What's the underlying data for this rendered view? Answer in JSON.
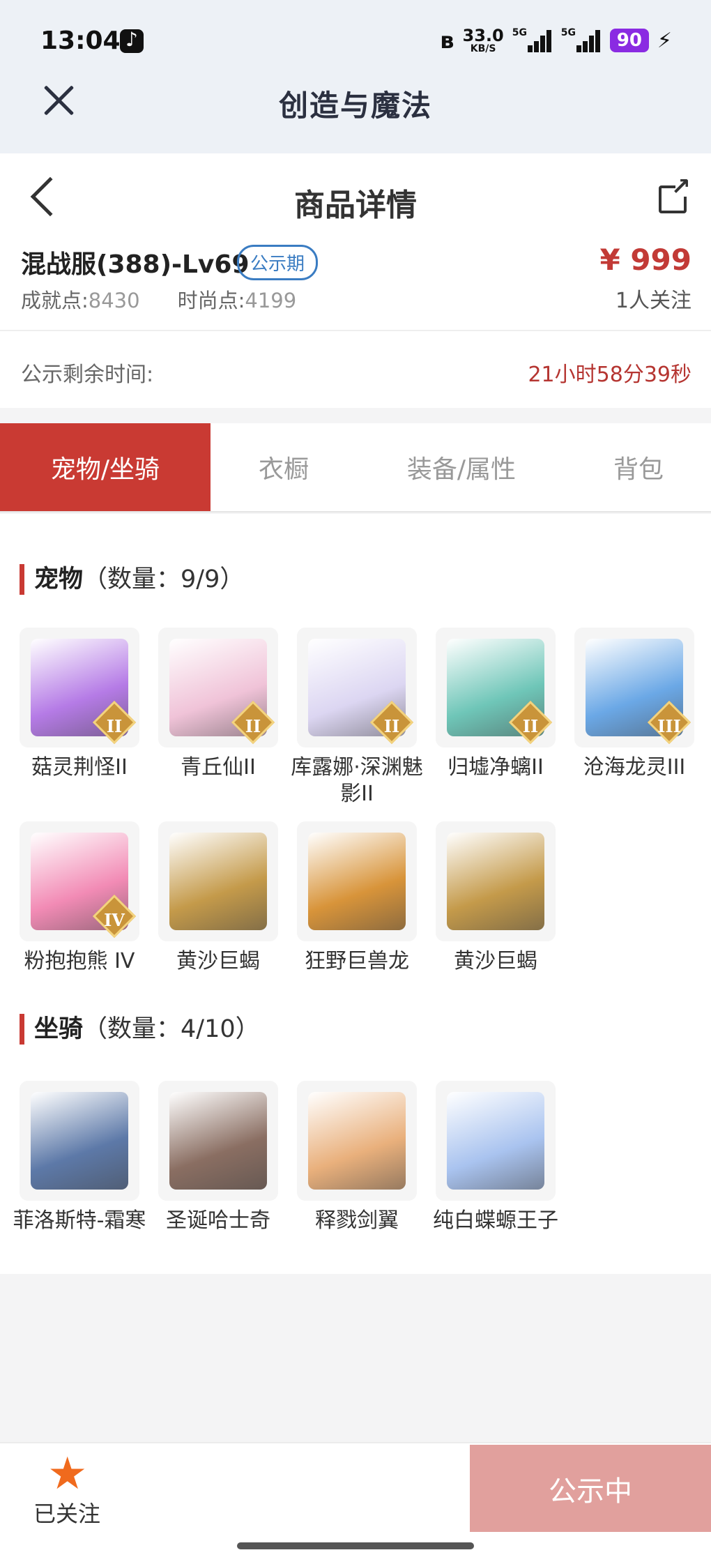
{
  "status_bar": {
    "time": "13:04",
    "net_speed_value": "33.0",
    "net_speed_unit": "KB/S",
    "signal1_label": "5G",
    "signal2_label": "5G",
    "battery": "90"
  },
  "app": {
    "title": "创造与魔法"
  },
  "page": {
    "title": "商品详情"
  },
  "item": {
    "name": "混战服(388)-Lv69",
    "badge": "公示期",
    "price": "¥ 999",
    "achievement_label": "成就点:",
    "achievement_value": "8430",
    "fashion_label": "时尚点:",
    "fashion_value": "4199",
    "followers": "1人关注"
  },
  "timer": {
    "label": "公示剩余时间:",
    "value": "21小时58分39秒"
  },
  "tabs": [
    {
      "label": "宠物/坐骑",
      "active": true
    },
    {
      "label": "衣橱",
      "active": false
    },
    {
      "label": "装备/属性",
      "active": false
    },
    {
      "label": "背包",
      "active": false
    }
  ],
  "pets": {
    "heading": "宠物",
    "count": "（数量：9/9）",
    "items": [
      {
        "name": "菇灵荆怪II",
        "rank": "II",
        "color": "#b57be6"
      },
      {
        "name": "青丘仙II",
        "rank": "II",
        "color": "#f0c3d8"
      },
      {
        "name": "库露娜·深渊魅影II",
        "rank": "II",
        "color": "#dcd6f2"
      },
      {
        "name": "归墟净螭II",
        "rank": "II",
        "color": "#6fc6b8"
      },
      {
        "name": "沧海龙灵III",
        "rank": "III",
        "color": "#6ba8e6"
      },
      {
        "name": "粉抱抱熊 IV",
        "rank": "IV",
        "color": "#f28bb5"
      },
      {
        "name": "黄沙巨蝎",
        "rank": "",
        "color": "#c49a4a"
      },
      {
        "name": "狂野巨兽龙",
        "rank": "",
        "color": "#d8943a"
      },
      {
        "name": "黄沙巨蝎",
        "rank": "",
        "color": "#c49a4a"
      }
    ]
  },
  "mounts": {
    "heading": "坐骑",
    "count": "（数量：4/10）",
    "items": [
      {
        "name": "菲洛斯特-霜寒",
        "color": "#5d79a8"
      },
      {
        "name": "圣诞哈士奇",
        "color": "#8a6e62"
      },
      {
        "name": "释戮剑翼",
        "color": "#e9b07c"
      },
      {
        "name": "纯白蝶螈王子",
        "color": "#a9c3ef"
      }
    ]
  },
  "bottom": {
    "follow_label": "已关注",
    "cta_label": "公示中"
  },
  "colors": {
    "accent": "#c93a33",
    "price": "#c23a36",
    "badge": "#3a7cc2",
    "star": "#f06a1d",
    "cta": "#e1a09d"
  }
}
